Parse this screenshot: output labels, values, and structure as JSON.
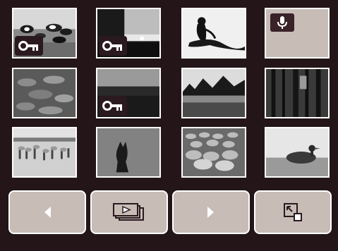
{
  "colors": {
    "background": "#231518",
    "card": "#c7bcb6",
    "border": "#ffffff",
    "badge": "#2a1a1f"
  },
  "thumbnails": [
    {
      "subject": "cows-in-field",
      "protected": true
    },
    {
      "subject": "sunset-over-water",
      "protected": true
    },
    {
      "subject": "monkey-on-branch",
      "protected": false
    },
    {
      "subject": "voice-memo",
      "protected": false
    },
    {
      "subject": "lily-pads",
      "protected": false
    },
    {
      "subject": "dark-landscape",
      "protected": true
    },
    {
      "subject": "lake-with-forest",
      "protected": false
    },
    {
      "subject": "pine-forest",
      "protected": false
    },
    {
      "subject": "flamingos",
      "protected": false
    },
    {
      "subject": "fox-in-grass",
      "protected": false
    },
    {
      "subject": "flock-of-sheep",
      "protected": false
    },
    {
      "subject": "duck-on-water",
      "protected": false
    }
  ],
  "buttons": [
    {
      "icon": "prev-arrow-icon"
    },
    {
      "icon": "slideshow-icon"
    },
    {
      "icon": "next-arrow-icon"
    },
    {
      "icon": "zoom-out-index-icon"
    }
  ]
}
